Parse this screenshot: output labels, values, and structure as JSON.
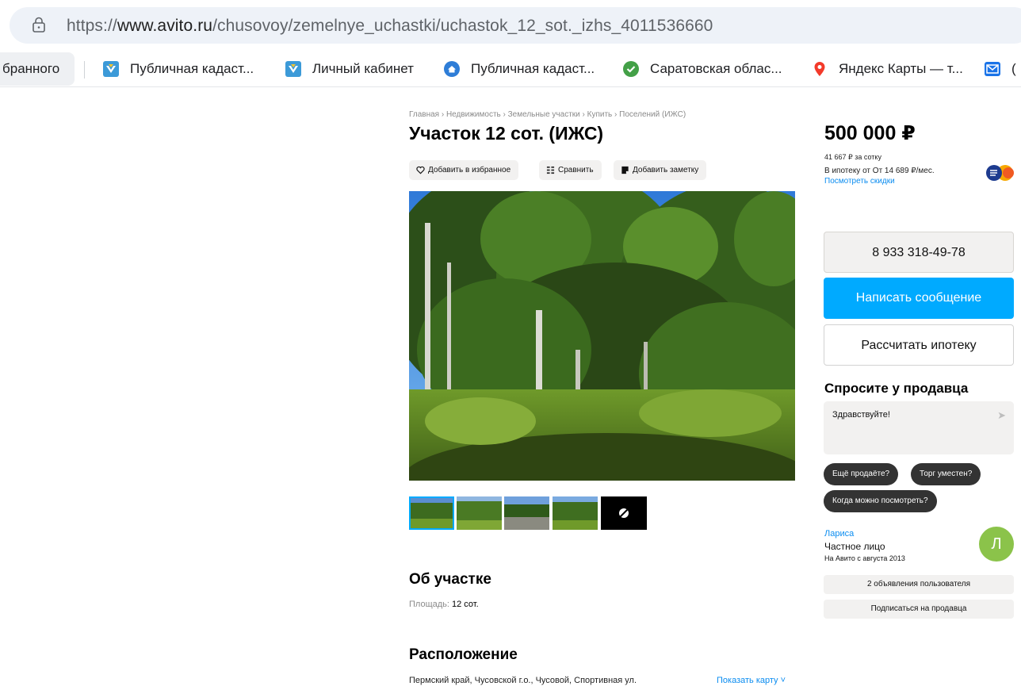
{
  "browser": {
    "url_prefix": "https://",
    "url_host": "www.avito.ru",
    "url_path": "/chusovoy/zemelnye_uchastki/uchastok_12_sot._izhs_4011536660",
    "bookmarks": [
      {
        "label": "бранного"
      },
      {
        "label": "Публичная кадаст...",
        "icon": "rosreestr-icon"
      },
      {
        "label": "Личный кабинет",
        "icon": "rosreestr-icon"
      },
      {
        "label": "Публичная кадаст...",
        "icon": "home-icon"
      },
      {
        "label": "Саратовская облас...",
        "icon": "check-circle-icon"
      },
      {
        "label": "Яндекс Карты — т...",
        "icon": "map-pin-icon"
      },
      {
        "label": "(",
        "icon": "mail-icon"
      }
    ]
  },
  "listing": {
    "breadcrumbs": "Главная › Недвижимость › Земельные участки › Купить › Поселений (ИЖС)",
    "title": "Участок 12 сот. (ИЖС)",
    "actions": {
      "favorite": "Добавить в избранное",
      "compare": "Сравнить",
      "note": "Добавить заметку"
    },
    "about_heading": "Об участке",
    "area_label": "Площадь:",
    "area_value": "12 сот.",
    "location_heading": "Расположение",
    "address": "Пермский край, Чусовской г.о., Чусовой, Спортивная ул.",
    "show_map": "Показать карту ˅"
  },
  "sidebar": {
    "price": "500 000 ₽",
    "price_per": "41 667 ₽ за сотку",
    "mortgage": "В ипотеку от От 14 689 ₽/мес.",
    "discounts": "Посмотреть скидки",
    "phone": "8 933 318-49-78",
    "message_btn": "Написать сообщение",
    "mortgage_btn": "Рассчитать ипотеку",
    "ask_heading": "Спросите у продавца",
    "ask_value": "Здравствуйте!",
    "chips": [
      "Ещё продаёте?",
      "Торг уместен?",
      "Когда можно посмотреть?"
    ],
    "seller": {
      "name": "Лариса",
      "type": "Частное лицо",
      "since": "На Авито с августа 2013",
      "avatar_letter": "Л",
      "avatar_color": "#8bc34a"
    },
    "user_ads_btn": "2 объявления пользователя",
    "subscribe_btn": "Подписаться на продавца"
  },
  "colors": {
    "accent": "#00aaff",
    "chip_bg": "#333333"
  }
}
